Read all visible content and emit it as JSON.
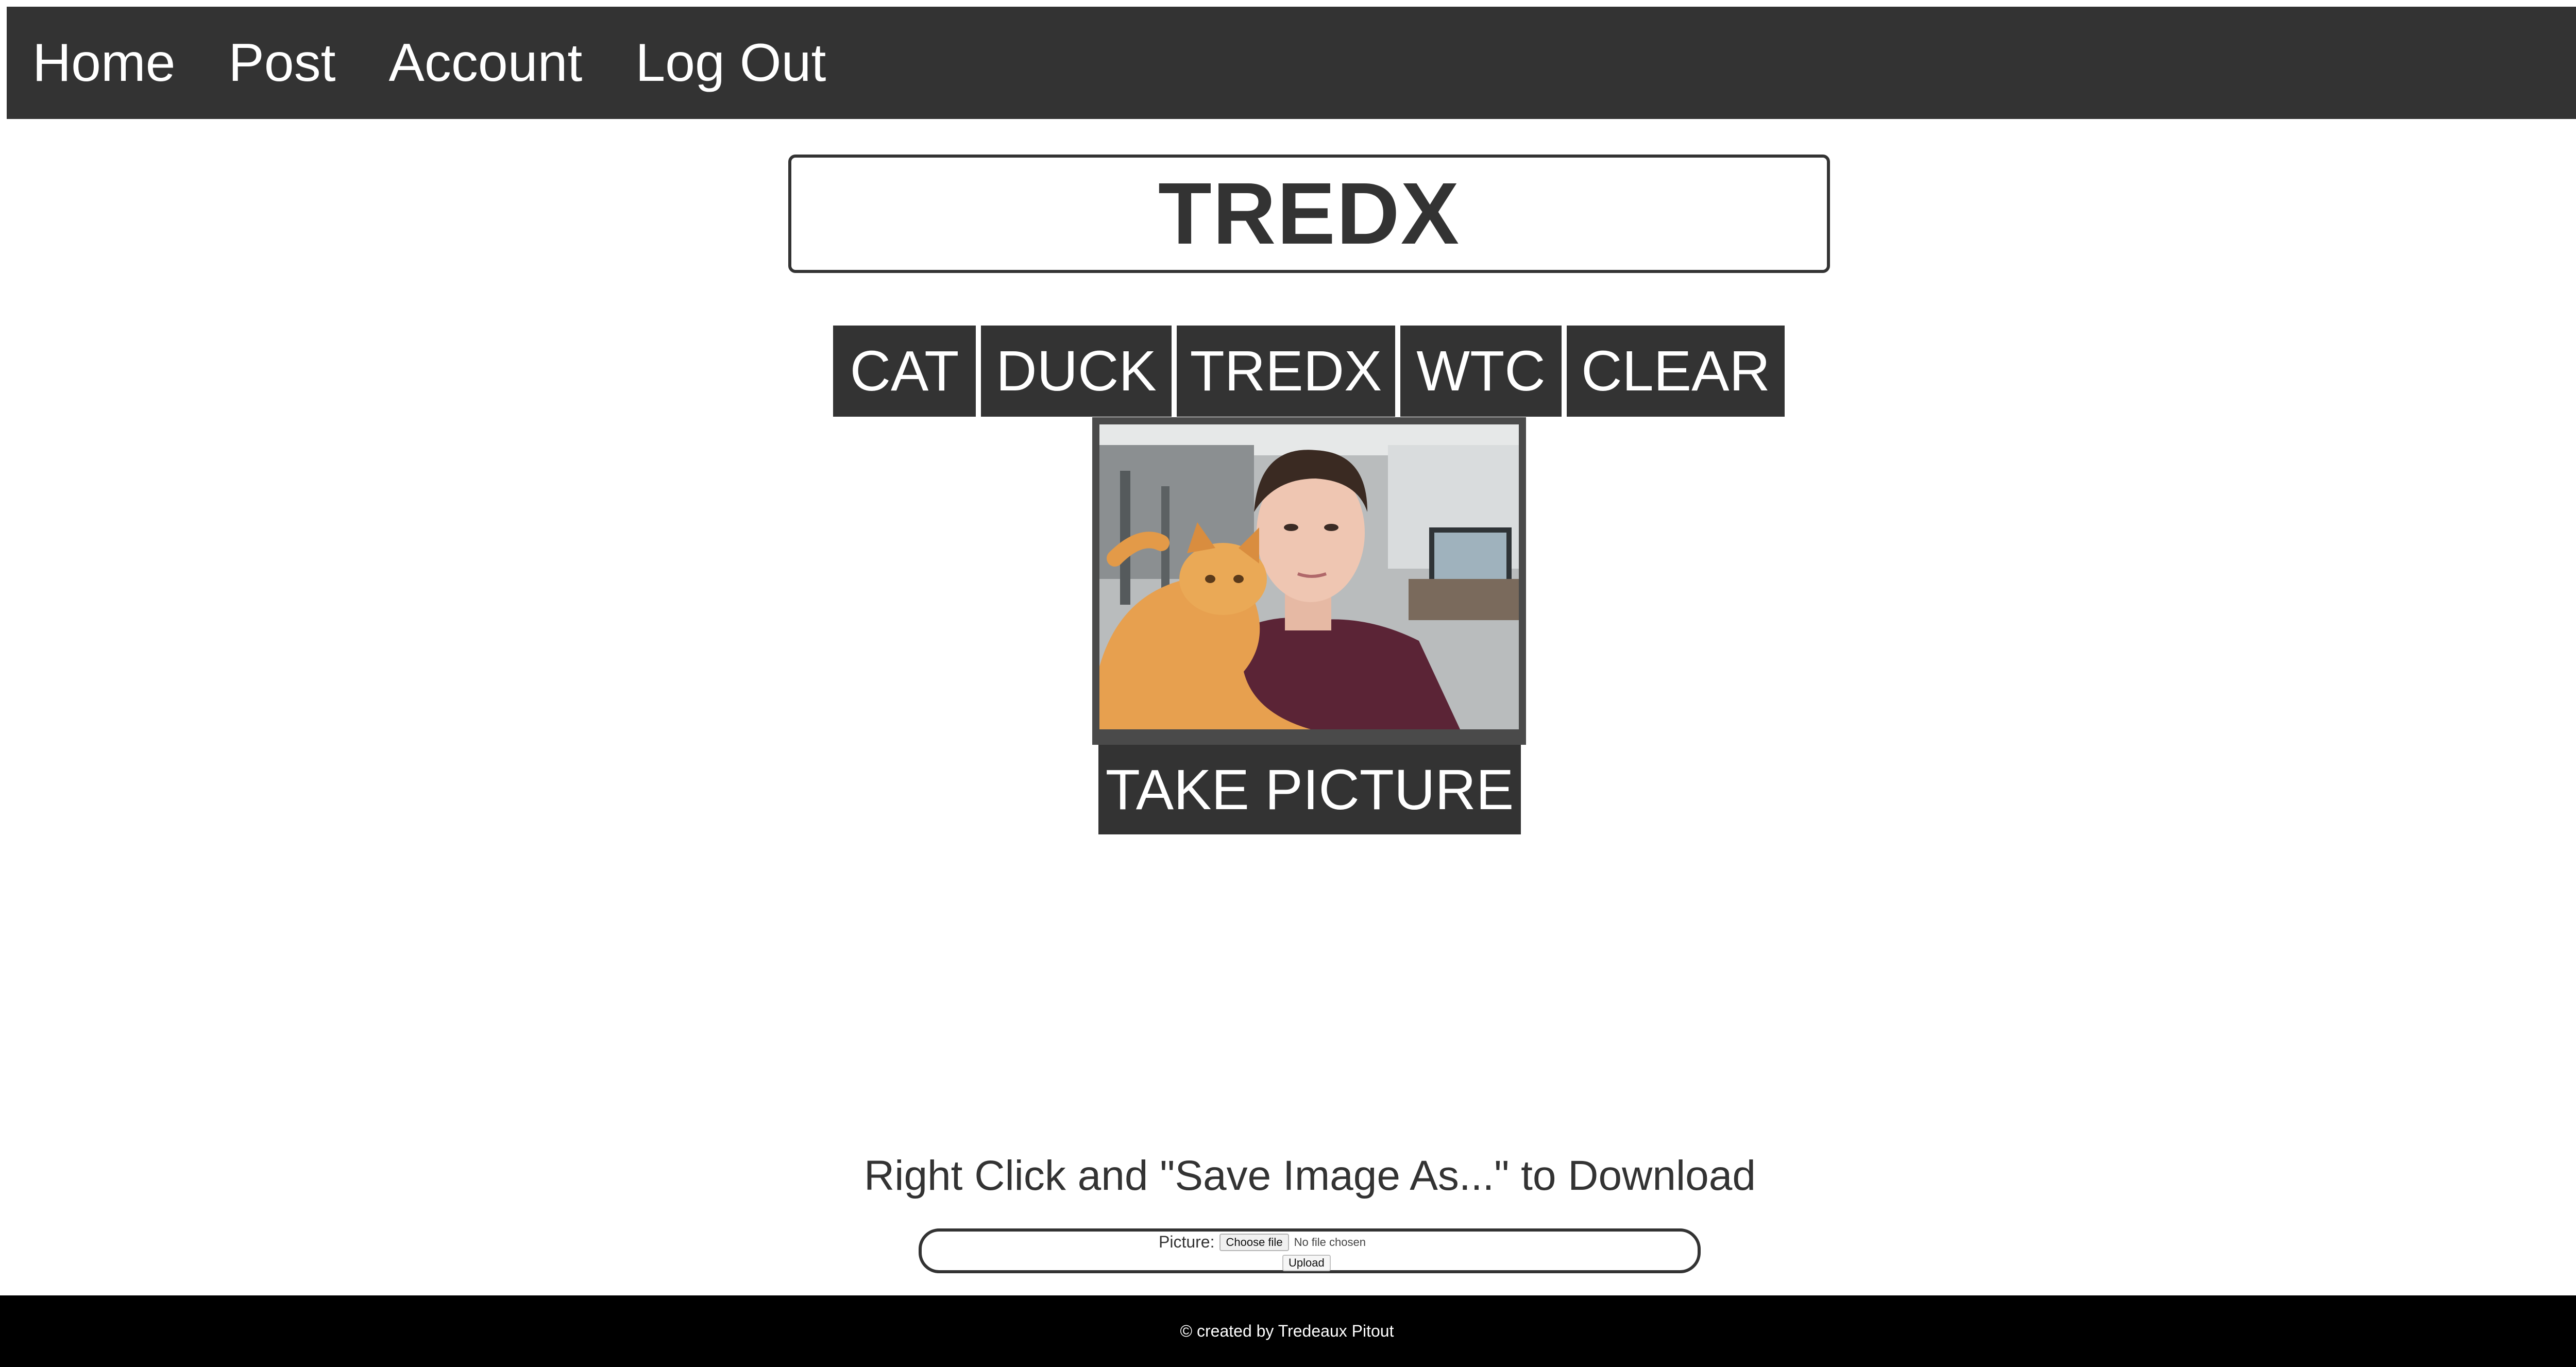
{
  "nav": {
    "items": [
      {
        "label": "Home"
      },
      {
        "label": "Post"
      },
      {
        "label": "Account"
      },
      {
        "label": "Log Out"
      }
    ]
  },
  "title": "TREDX",
  "stickers": {
    "cat": "CAT",
    "duck": "DUCK",
    "tredx": "TREDX",
    "wtc": "WTC",
    "clear": "CLEAR"
  },
  "camera": {
    "take_picture_label": "TAKE PICTURE"
  },
  "download_hint": "Right Click and \"Save Image As...\" to Download",
  "upload": {
    "label": "Picture:",
    "choose_file": "Choose file",
    "file_status": "No file chosen",
    "upload_button": "Upload"
  },
  "footer": {
    "text": "© created by Tredeaux Pitout"
  },
  "colors": {
    "nav_bg": "#333333",
    "button_bg": "#333333",
    "footer_bg": "#000000"
  }
}
